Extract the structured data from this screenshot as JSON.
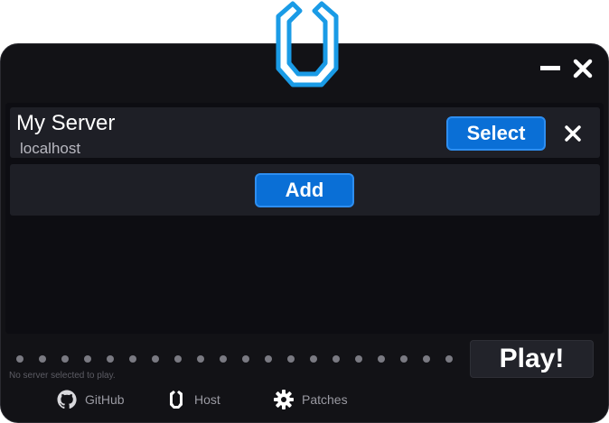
{
  "window": {
    "minimize_icon": "minus-icon",
    "close_icon": "close-icon",
    "logo": "launcher-logo"
  },
  "servers": [
    {
      "name": "My Server",
      "host": "localhost",
      "select_label": "Select",
      "remove_icon": "close-icon"
    }
  ],
  "add_label": "Add",
  "play_label": "Play!",
  "status": "No server selected to play.",
  "loading_dots": 20,
  "footer": {
    "github": {
      "label": "GitHub",
      "icon": "github-icon"
    },
    "host": {
      "label": "Host",
      "icon": "host-logo-icon"
    },
    "patches": {
      "label": "Patches",
      "icon": "gear-icon"
    }
  },
  "colors": {
    "accent": "#0a6fd6",
    "accent_border": "#2e8ef0",
    "background": "#121216",
    "row": "#1e1f26",
    "logo": "#1a9be6"
  }
}
